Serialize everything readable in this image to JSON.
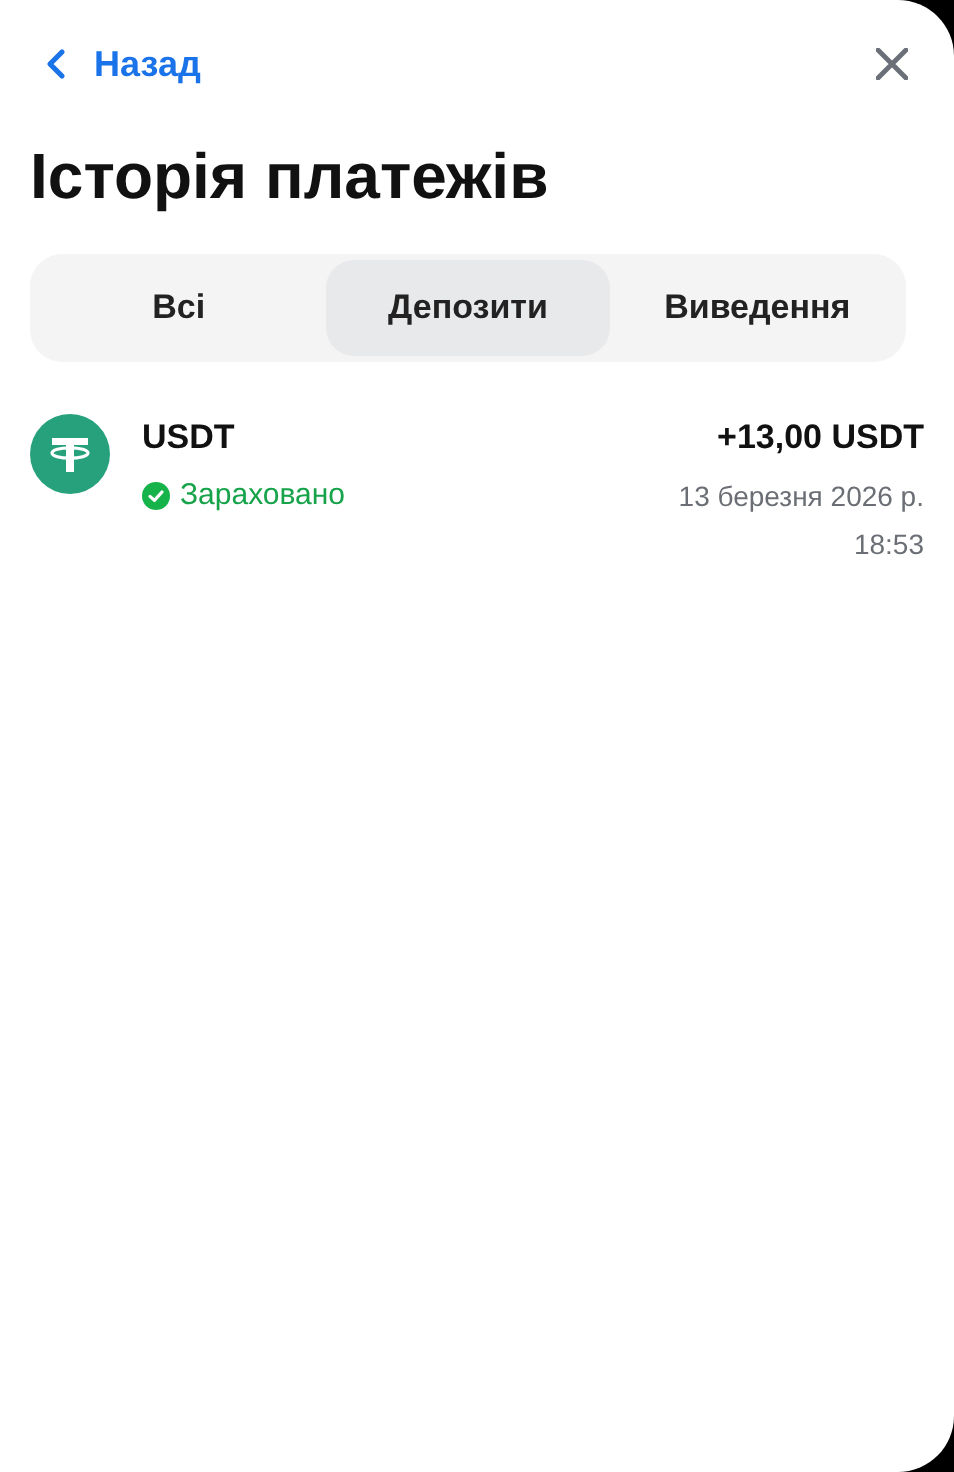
{
  "back": {
    "label": "Назад"
  },
  "title": "Історія платежів",
  "tabs": [
    {
      "label": "Всі",
      "selected": false
    },
    {
      "label": "Депозити",
      "selected": true
    },
    {
      "label": "Виведення",
      "selected": false
    }
  ],
  "payments": [
    {
      "asset": "USDT",
      "status": "Зараховано",
      "credited": true,
      "amount": "+13,00 USDT",
      "date": "13 березня 2026 р.",
      "time": "18:53"
    }
  ]
}
